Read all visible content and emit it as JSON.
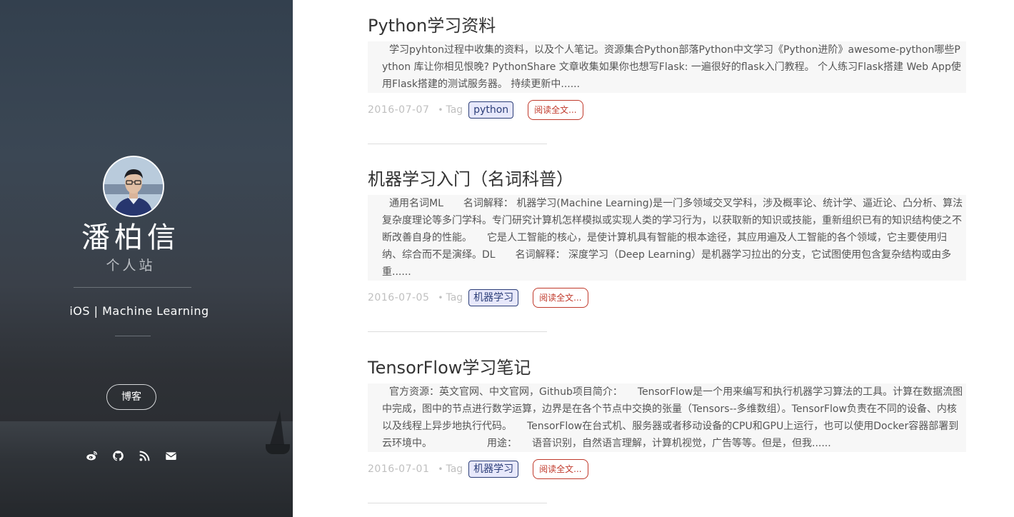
{
  "sidebar": {
    "name": "潘柏信",
    "subtitle": "个人站",
    "tagline": "iOS | Machine Learning",
    "blog_button": "博客",
    "social_icons": [
      "weibo-icon",
      "github-icon",
      "rss-icon",
      "mail-icon"
    ]
  },
  "posts": [
    {
      "title": "Python学习资料",
      "excerpt": "学习pyhton过程中收集的资料，以及个人笔记。资源集合Python部落Python中文学习《Python进阶》awesome-python哪些Python 库让你相见恨晚? PythonShare 文章收集如果你也想写Flask: 一遍很好的flask入门教程。 个人练习Flask搭建 Web App使用Flask搭建的测试服务器。 持续更新中......",
      "date": "2016-07-07",
      "tag_label": "Tag",
      "tag": "python",
      "read_more": "阅读全文..."
    },
    {
      "title": "机器学习入门（名词科普）",
      "excerpt": "通用名词ML　　名词解释：  机器学习(Machine Learning)是一门多领域交叉学科，涉及概率论、统计学、逼近论、凸分析、算法复杂度理论等多门学科。专门研究计算机怎样模拟或实现人类的学习行为，以获取新的知识或技能，重新组织已有的知识结构使之不断改善自身的性能。　　它是人工智能的核心，是使计算机具有智能的根本途径，其应用遍及人工智能的各个领域，它主要使用归纳、综合而不是演绎。DL　　名词解释：  深度学习（Deep Learning）是机器学习拉出的分支，它试图使用包含复杂结构或由多重......",
      "date": "2016-07-05",
      "tag_label": "Tag",
      "tag": "机器学习",
      "read_more": "阅读全文..."
    },
    {
      "title": "TensorFlow学习笔记",
      "excerpt": "官方资源：英文官网、中文官网，Github项目简介：　　TensorFlow是一个用来编写和执行机器学习算法的工具。计算在数据流图中完成，图中的节点进行数学运算，边界是在各个节点中交换的张量（Tensors--多维数组）。TensorFlow负责在不同的设备、内核以及线程上异步地执行代码。　　TensorFlow在台式机、服务器或者移动设备的CPU和GPU上运行，也可以使用Docker容器部署到云环境中。　　　　　　用途：　　语音识别，自然语言理解，计算机视觉，广告等等。但是，但我......",
      "date": "2016-07-01",
      "tag_label": "Tag",
      "tag": "机器学习",
      "read_more": "阅读全文..."
    }
  ]
}
